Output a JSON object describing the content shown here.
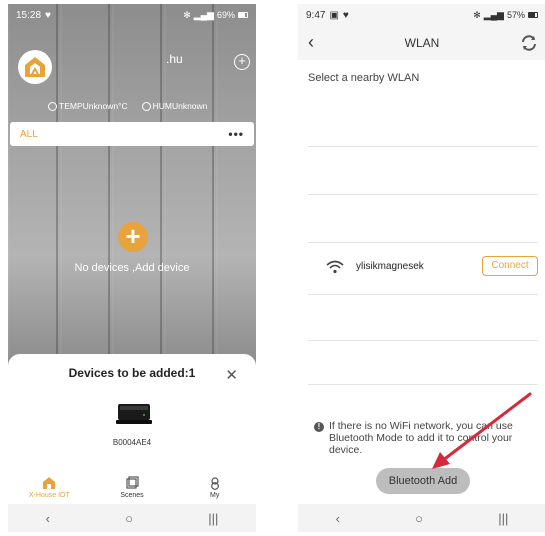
{
  "left": {
    "status": {
      "time": "15:28",
      "battery": "69%"
    },
    "domain": ".hu",
    "temp_label": "TEMPUnknown°C",
    "hum_label": "HUMUnknown",
    "filter_label": "ALL",
    "more_label": "•••",
    "empty_text": "No devices ,Add device",
    "sheet": {
      "title": "Devices to be added:1",
      "device_id": "B0004AE4"
    },
    "tabs": [
      {
        "label": "X-House IOT"
      },
      {
        "label": "Scenes"
      },
      {
        "label": "My"
      }
    ],
    "accent": "#e8a33d"
  },
  "right": {
    "status": {
      "time": "9:47",
      "battery": "57%"
    },
    "title": "WLAN",
    "subtitle": "Select a nearby WLAN",
    "networks": [
      {
        "ssid": "ylisikmagnesek",
        "action": "Connect"
      }
    ],
    "info": "If there is no WiFi network, you can use Bluetooth Mode to add it to control your device.",
    "bt_button": "Bluetooth Add",
    "arrow_color": "#d62a3a"
  },
  "nav": {
    "back": "‹",
    "home": "○",
    "recents": "|||"
  }
}
